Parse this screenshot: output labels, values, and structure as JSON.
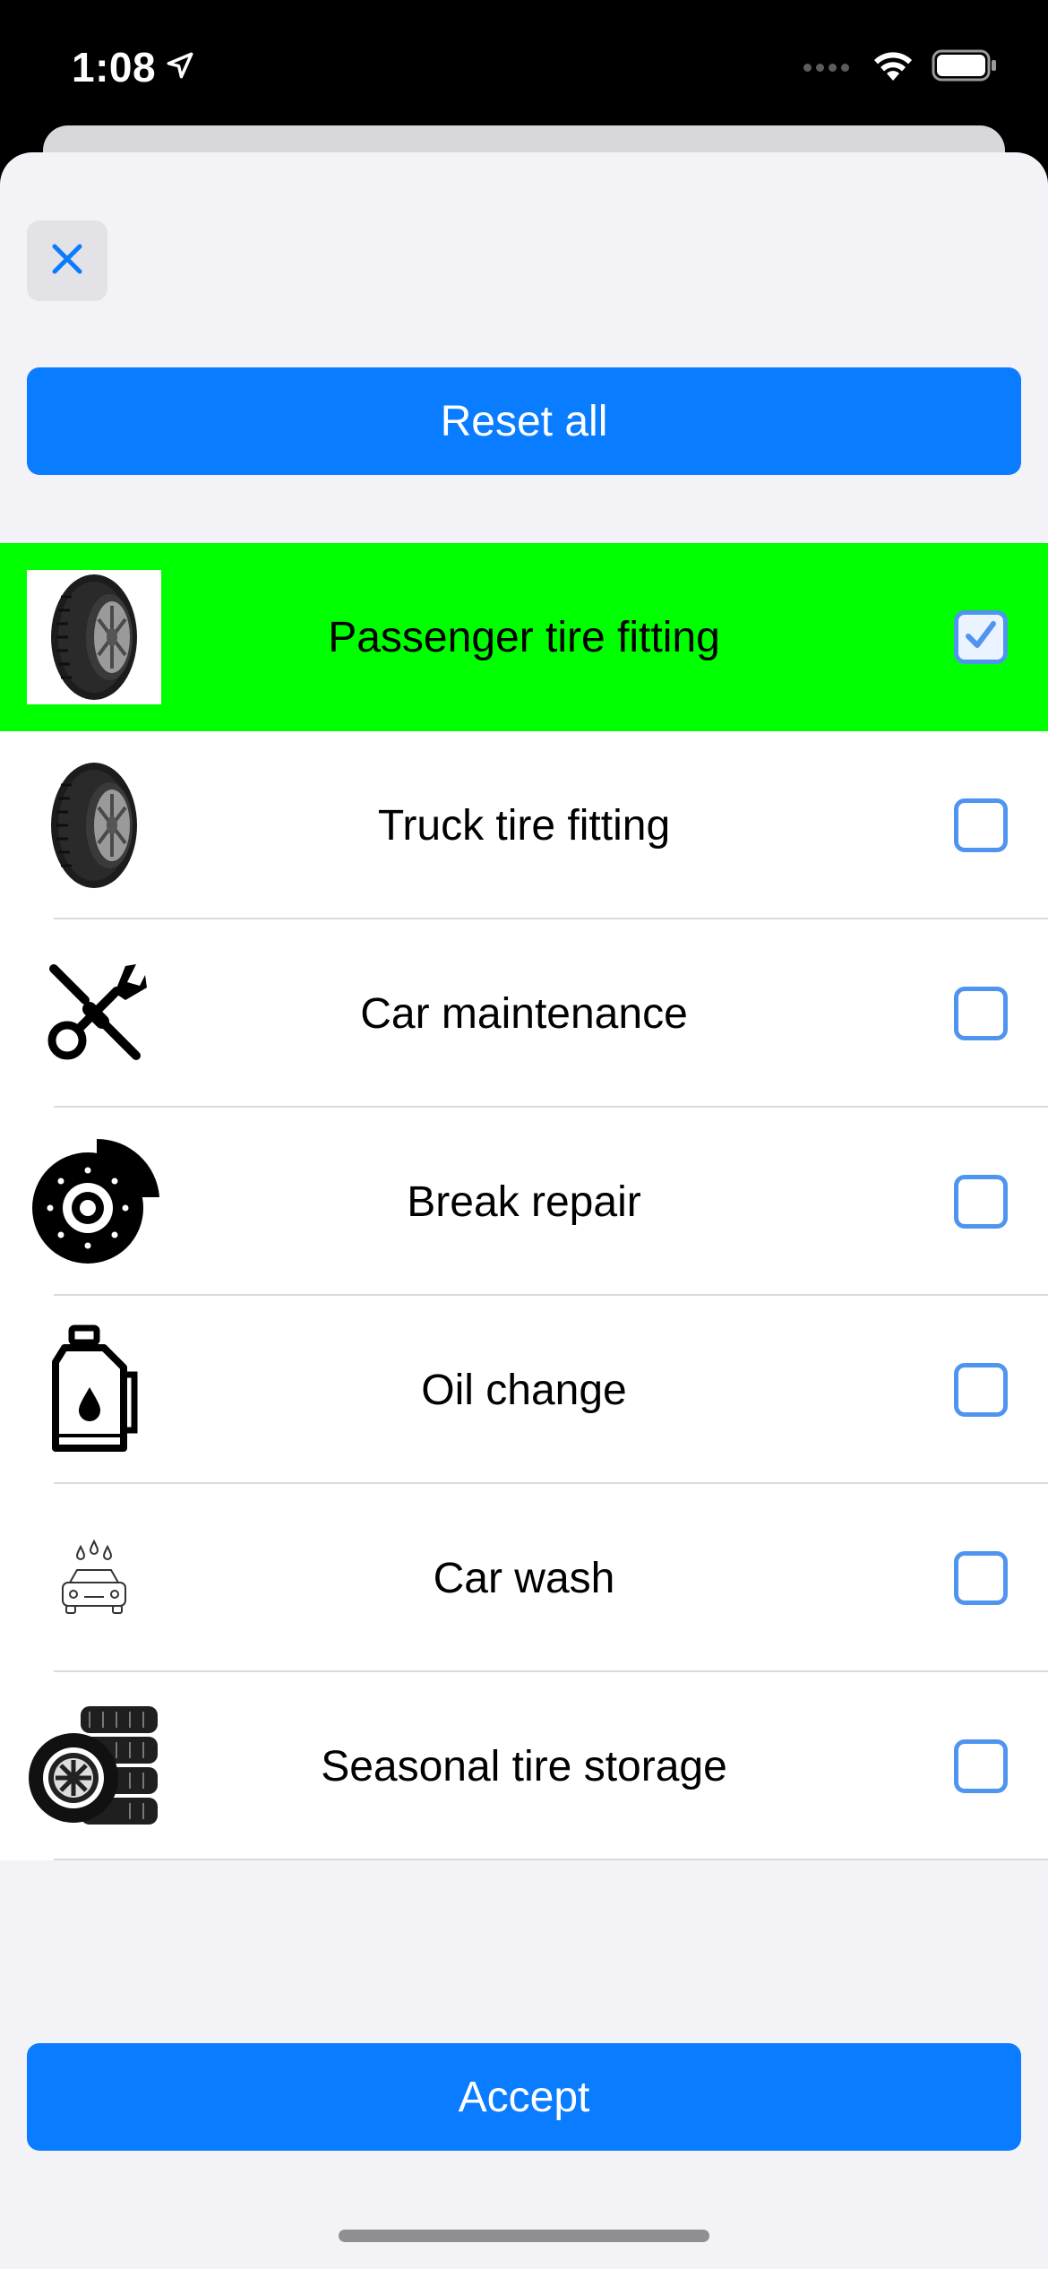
{
  "status_bar": {
    "time": "1:08",
    "location_icon": "location-arrow-icon",
    "wifi_icon": "wifi-icon",
    "battery_icon": "battery-icon"
  },
  "sheet": {
    "close_icon": "close-icon",
    "reset_button_label": "Reset all",
    "accept_button_label": "Accept"
  },
  "services": [
    {
      "label": "Passenger tire fitting",
      "icon": "tire-icon",
      "selected": true
    },
    {
      "label": "Truck tire fitting",
      "icon": "tire-icon",
      "selected": false
    },
    {
      "label": "Car maintenance",
      "icon": "wrench-screwdriver-icon",
      "selected": false
    },
    {
      "label": "Break repair",
      "icon": "brake-disc-icon",
      "selected": false
    },
    {
      "label": "Oil change",
      "icon": "oil-canister-icon",
      "selected": false
    },
    {
      "label": "Car wash",
      "icon": "car-wash-icon",
      "selected": false
    },
    {
      "label": "Seasonal tire storage",
      "icon": "tire-stack-icon",
      "selected": false
    }
  ],
  "colors": {
    "accent": "#0a7cff",
    "selected_row": "#00ff00",
    "checkbox_border": "#4f94ef",
    "sheet_background": "#f2f2f7"
  }
}
